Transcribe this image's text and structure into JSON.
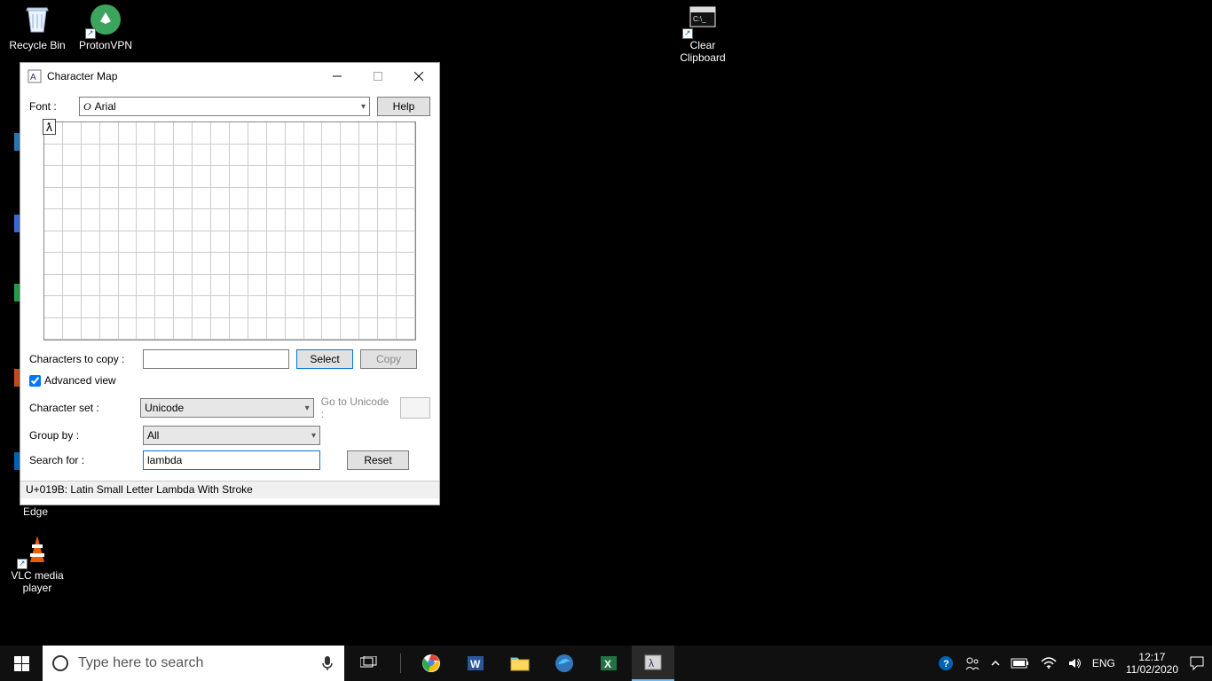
{
  "desktop": {
    "icons": [
      {
        "label": "Recycle Bin"
      },
      {
        "label": "ProtonVPN"
      },
      {
        "label": "Clear\nClipboard"
      },
      {
        "label": "VLC media\nplayer"
      }
    ],
    "partial_edge_label": "Edge"
  },
  "window": {
    "title": "Character Map",
    "font_label": "Font :",
    "font_value": "Arial",
    "help_btn": "Help",
    "selected_char": "ƛ",
    "chars_to_copy_label": "Characters to copy :",
    "select_btn": "Select",
    "copy_btn": "Copy",
    "advanced_view": "Advanced view",
    "charset_label": "Character set :",
    "charset_value": "Unicode",
    "goto_unicode_label": "Go to Unicode :",
    "groupby_label": "Group by :",
    "groupby_value": "All",
    "search_label": "Search for :",
    "search_value": "lambda",
    "reset_btn": "Reset",
    "status": "U+019B: Latin Small Letter Lambda With Stroke"
  },
  "taskbar": {
    "search_placeholder": "Type here to search",
    "lang": "ENG",
    "time": "12:17",
    "date": "11/02/2020"
  }
}
